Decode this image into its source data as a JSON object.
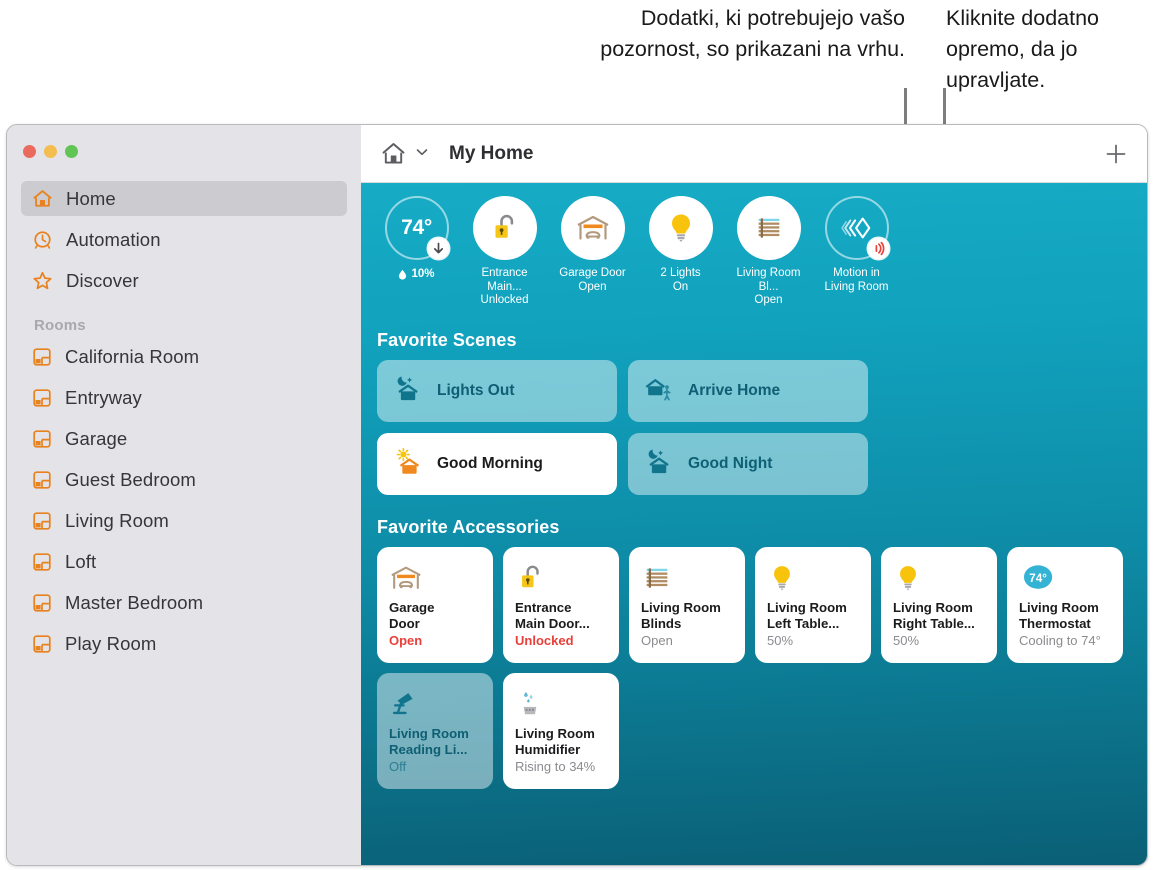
{
  "callouts": {
    "left": "Dodatki, ki potrebujejo vašo pozornost, so prikazani na vrhu.",
    "right": "Kliknite dodatno opremo, da jo upravljate."
  },
  "window": {
    "traffic_lights": [
      "close",
      "minimize",
      "zoom"
    ],
    "accent": "#e8821e",
    "background_top": "#17abc6",
    "background_bottom": "#0a5f76"
  },
  "sidebar": {
    "nav": [
      {
        "label": "Home",
        "icon": "house-icon",
        "selected": true
      },
      {
        "label": "Automation",
        "icon": "clock-icon",
        "selected": false
      },
      {
        "label": "Discover",
        "icon": "star-icon",
        "selected": false
      }
    ],
    "rooms_header": "Rooms",
    "rooms": [
      {
        "label": "California Room",
        "icon": "room-icon"
      },
      {
        "label": "Entryway",
        "icon": "room-icon"
      },
      {
        "label": "Garage",
        "icon": "room-icon"
      },
      {
        "label": "Guest Bedroom",
        "icon": "room-icon"
      },
      {
        "label": "Living Room",
        "icon": "room-icon"
      },
      {
        "label": "Loft",
        "icon": "room-icon"
      },
      {
        "label": "Master Bedroom",
        "icon": "room-icon"
      },
      {
        "label": "Play Room",
        "icon": "room-icon"
      }
    ]
  },
  "toolbar": {
    "home_icon": "house-icon",
    "chevron_icon": "chevron-down-icon",
    "title": "My Home",
    "add_icon": "plus-icon"
  },
  "status_strip": [
    {
      "type": "thermostat",
      "temp": "74°",
      "humidity": "10%",
      "humidity_icon": "droplet-icon",
      "badge": "arrow-down-icon",
      "label": ""
    },
    {
      "type": "lock",
      "icon": "unlocked-padlock-icon",
      "name": "Entrance Main...",
      "state": "Unlocked"
    },
    {
      "type": "garage",
      "icon": "garage-door-icon",
      "name": "Garage Door",
      "state": "Open"
    },
    {
      "type": "light",
      "icon": "lightbulb-icon",
      "name": "2 Lights",
      "state": "On"
    },
    {
      "type": "blinds",
      "icon": "blinds-icon",
      "name": "Living Room Bl...",
      "state": "Open"
    },
    {
      "type": "motion",
      "icon": "motion-sensor-icon",
      "badge": "motion-alert-icon",
      "name": "Motion in",
      "state": "Living Room"
    }
  ],
  "scenes_title": "Favorite Scenes",
  "scenes": [
    {
      "label": "Lights Out",
      "icon": "moon-house-icon",
      "active": false
    },
    {
      "label": "Arrive Home",
      "icon": "house-person-icon",
      "active": false
    },
    {
      "label": "Good Morning",
      "icon": "sun-house-icon",
      "active": true
    },
    {
      "label": "Good Night",
      "icon": "moon-house-icon",
      "active": false
    }
  ],
  "accessories_title": "Favorite Accessories",
  "accessories": [
    {
      "name": "Garage\nDoor",
      "state": "Open",
      "icon": "garage-door-icon",
      "on": true,
      "alert": true
    },
    {
      "name": "Entrance\nMain Door...",
      "state": "Unlocked",
      "icon": "unlocked-padlock-icon",
      "on": true,
      "alert": true
    },
    {
      "name": "Living Room\nBlinds",
      "state": "Open",
      "icon": "blinds-icon",
      "on": true,
      "alert": false
    },
    {
      "name": "Living Room\nLeft Table...",
      "state": "50%",
      "icon": "lightbulb-icon",
      "on": true,
      "alert": false
    },
    {
      "name": "Living Room\nRight Table...",
      "state": "50%",
      "icon": "lightbulb-icon",
      "on": true,
      "alert": false
    },
    {
      "name": "Living Room\nThermostat",
      "state": "Cooling to 74°",
      "icon": "thermostat-icon",
      "on": true,
      "alert": false,
      "temp": "74°"
    },
    {
      "name": "Living Room\nReading Li...",
      "state": "Off",
      "icon": "desk-lamp-icon",
      "on": false,
      "alert": false
    },
    {
      "name": "Living Room\nHumidifier",
      "state": "Rising to 34%",
      "icon": "humidifier-icon",
      "on": true,
      "alert": false
    }
  ]
}
